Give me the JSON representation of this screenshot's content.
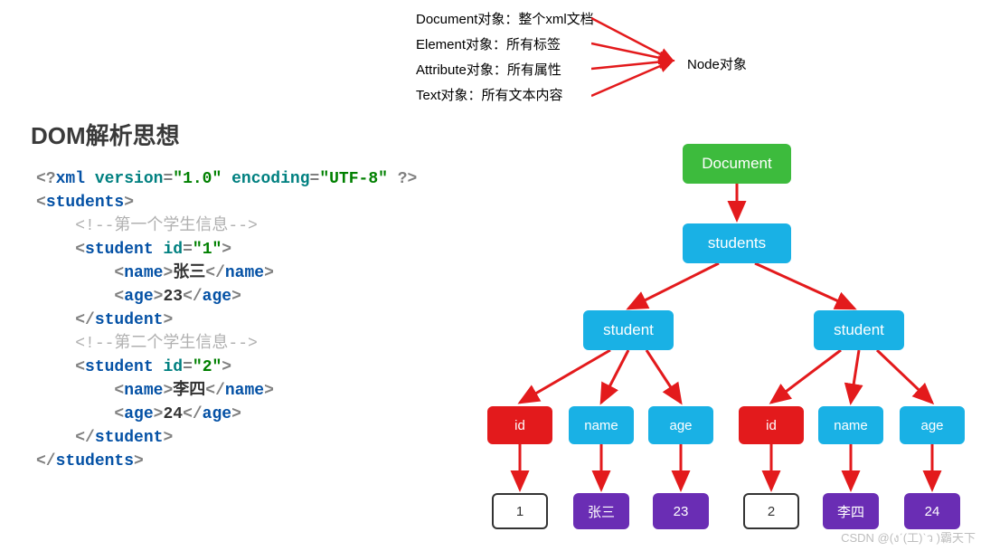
{
  "header": {
    "rows": {
      "document": {
        "label": "Document对象：",
        "desc": "整个xml文档"
      },
      "element": {
        "label": "Element对象：",
        "desc": "所有标签"
      },
      "attribute": {
        "label": "Attribute对象：",
        "desc": "所有属性"
      },
      "text": {
        "label": "Text对象：",
        "desc": "所有文本内容"
      }
    },
    "node_label": "Node对象"
  },
  "title": "DOM解析思想",
  "code": {
    "xml_decl_open": "<?",
    "xml_decl_tag": "xml ",
    "version_attr": "version",
    "version_val": "\"1.0\"",
    "encoding_attr": "encoding",
    "encoding_val": "\"UTF-8\"",
    "xml_decl_close": " ?>",
    "students_open": "students",
    "comment1": "<!--第一个学生信息-->",
    "student_tag": "student",
    "id_attr": "id",
    "id1_val": "\"1\"",
    "id2_val": "\"2\"",
    "name_tag": "name",
    "name1_val": "张三",
    "name2_val": "李四",
    "age_tag": "age",
    "age1_val": "23",
    "age2_val": "24",
    "comment2": "<!--第二个学生信息-->",
    "lt": "<",
    "gt": ">",
    "lts": "</",
    "eq": "="
  },
  "tree": {
    "doc": "Document",
    "students": "students",
    "student": "student",
    "id": "id",
    "name": "name",
    "age": "age",
    "leaf": {
      "id1": "1",
      "name1": "张三",
      "age1": "23",
      "id2": "2",
      "name2": "李四",
      "age2": "24"
    }
  },
  "watermark": "CSDN @(งˊ(工)ˋว )霸天下",
  "chart_data": {
    "type": "tree",
    "title": "DOM解析思想",
    "root": {
      "name": "Document",
      "kind": "document",
      "children": [
        {
          "name": "students",
          "kind": "element",
          "children": [
            {
              "name": "student",
              "kind": "element",
              "children": [
                {
                  "name": "id",
                  "kind": "attribute",
                  "children": [
                    {
                      "name": "1",
                      "kind": "value"
                    }
                  ]
                },
                {
                  "name": "name",
                  "kind": "element",
                  "children": [
                    {
                      "name": "张三",
                      "kind": "text"
                    }
                  ]
                },
                {
                  "name": "age",
                  "kind": "element",
                  "children": [
                    {
                      "name": "23",
                      "kind": "text"
                    }
                  ]
                }
              ]
            },
            {
              "name": "student",
              "kind": "element",
              "children": [
                {
                  "name": "id",
                  "kind": "attribute",
                  "children": [
                    {
                      "name": "2",
                      "kind": "value"
                    }
                  ]
                },
                {
                  "name": "name",
                  "kind": "element",
                  "children": [
                    {
                      "name": "李四",
                      "kind": "text"
                    }
                  ]
                },
                {
                  "name": "age",
                  "kind": "element",
                  "children": [
                    {
                      "name": "24",
                      "kind": "text"
                    }
                  ]
                }
              ]
            }
          ]
        }
      ]
    },
    "legend": {
      "Document对象": "整个xml文档",
      "Element对象": "所有标签",
      "Attribute对象": "所有属性",
      "Text对象": "所有文本内容",
      "all_are": "Node对象"
    }
  }
}
